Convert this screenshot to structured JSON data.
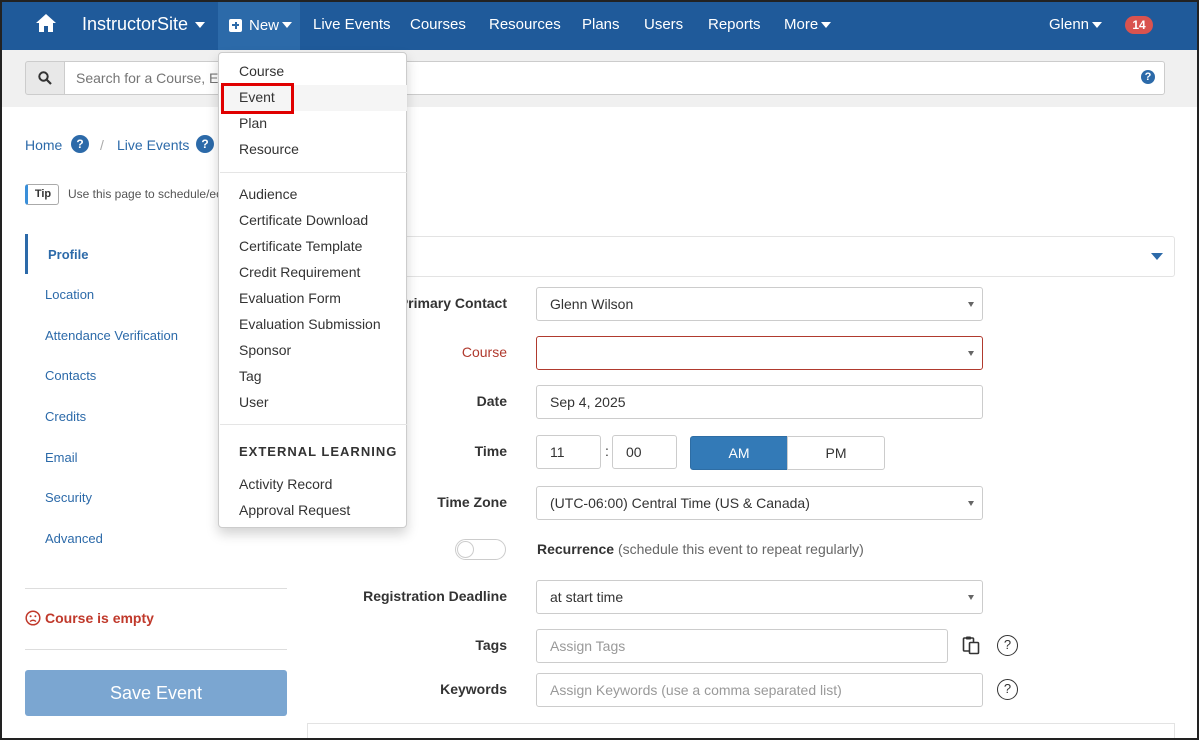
{
  "nav": {
    "brand": "InstructorSite",
    "new_label": "New",
    "items": [
      "Live Events",
      "Courses",
      "Resources",
      "Plans",
      "Users",
      "Reports",
      "More"
    ],
    "user": "Glenn",
    "notifications": "14"
  },
  "search": {
    "placeholder": "Search for a Course, Ev"
  },
  "breadcrumb": [
    "Home",
    "Live Events"
  ],
  "tip": {
    "badge": "Tip",
    "text": "Use this page to schedule/ec"
  },
  "sidebar": {
    "items": [
      "Profile",
      "Location",
      "Attendance Verification",
      "Contacts",
      "Credits",
      "Email",
      "Security",
      "Advanced"
    ],
    "warning": "Course is empty",
    "save": "Save Event"
  },
  "form": {
    "primary_contact": {
      "label": "Primary Contact",
      "value": "Glenn Wilson"
    },
    "course": {
      "label": "Course",
      "value": ""
    },
    "date": {
      "label": "Date",
      "value": "Sep 4, 2025"
    },
    "time": {
      "label": "Time",
      "hour": "11",
      "minute": "00",
      "am": "AM",
      "pm": "PM",
      "selected": "AM"
    },
    "timezone": {
      "label": "Time Zone",
      "value": "(UTC-06:00) Central Time (US & Canada)"
    },
    "recurrence": {
      "label": "Recurrence",
      "hint": "(schedule this event to repeat regularly)",
      "enabled": false
    },
    "deadline": {
      "label": "Registration Deadline",
      "value": "at start time"
    },
    "tags": {
      "label": "Tags",
      "placeholder": "Assign Tags"
    },
    "keywords": {
      "label": "Keywords",
      "placeholder": "Assign Keywords (use a comma separated list)"
    }
  },
  "dropdown": {
    "group1": [
      "Course",
      "Event",
      "Plan",
      "Resource"
    ],
    "group2": [
      "Audience",
      "Certificate Download",
      "Certificate Template",
      "Credit Requirement",
      "Evaluation Form",
      "Evaluation Submission",
      "Sponsor",
      "Tag",
      "User"
    ],
    "heading": "EXTERNAL LEARNING",
    "group3": [
      "Activity Record",
      "Approval Request"
    ],
    "highlighted": "Event"
  },
  "colors": {
    "nav": "#1f5a9a",
    "accent": "#2c6aa9",
    "error": "#b03a2e",
    "highlight_box": "#e00000"
  }
}
